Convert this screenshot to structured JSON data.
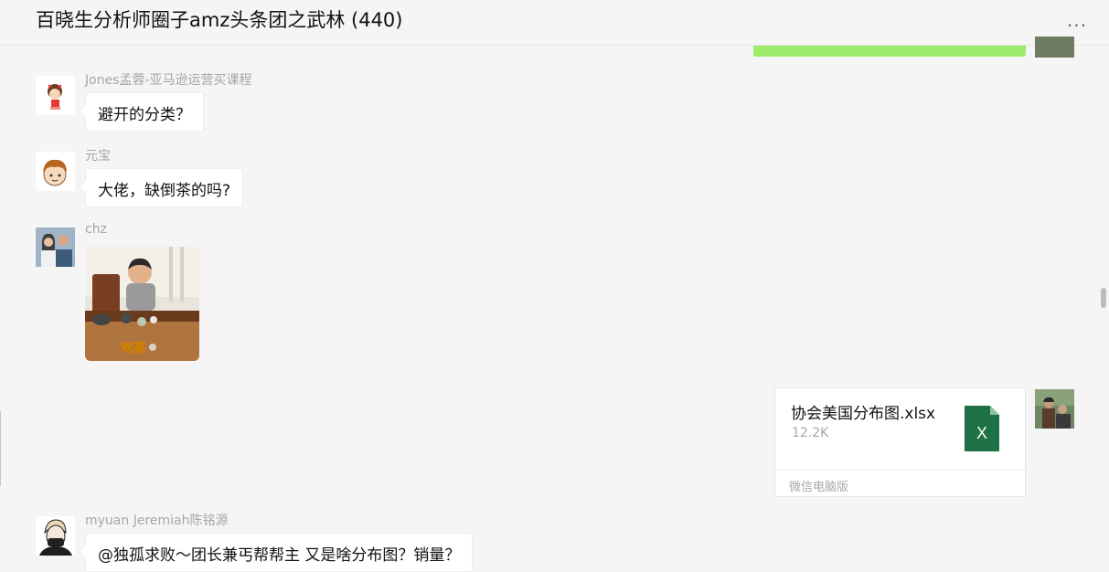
{
  "header": {
    "title": "百晓生分析师圈子amz头条团之武林 (440)",
    "more_label": "···"
  },
  "messages": [
    {
      "sender": "Jones孟蓉-亚马逊运营买课程",
      "text": "避开的分类？",
      "avatar": "cartoon-girl-avatar"
    },
    {
      "sender": "元宝",
      "text": "大佬，缺倒茶的吗?",
      "avatar": "cartoon-boy-avatar"
    },
    {
      "sender": "chz",
      "type": "image",
      "image_caption": "吃茶",
      "avatar": "couple-photo-avatar"
    },
    {
      "sender": "myuan Jeremiah陈铭源",
      "text": "@独孤求败～团长兼丐帮帮主 又是啥分布图？销量？",
      "avatar": "masked-person-avatar"
    }
  ],
  "file_message": {
    "name": "协会美国分布图.xlsx",
    "size": "12.2K",
    "icon_letter": "X",
    "source": "微信电脑版"
  },
  "colors": {
    "self_bubble": "#9eea6a",
    "excel_green": "#1e7145",
    "background": "#f5f5f5"
  }
}
